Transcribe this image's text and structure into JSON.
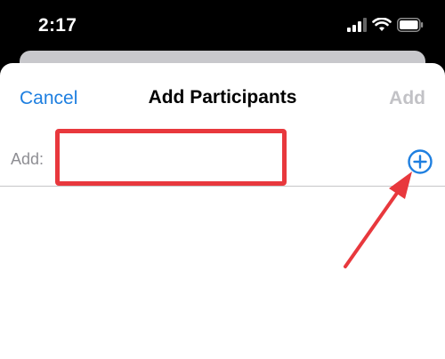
{
  "status_bar": {
    "time": "2:17",
    "icons": [
      "signal-icon",
      "wifi-icon",
      "battery-icon"
    ]
  },
  "sheet": {
    "cancel_label": "Cancel",
    "title": "Add Participants",
    "add_label": "Add",
    "field_label": "Add:",
    "input_value": ""
  },
  "colors": {
    "accent": "#1e7fe0",
    "disabled": "#c2c2c6",
    "annotation": "#e8383d"
  }
}
